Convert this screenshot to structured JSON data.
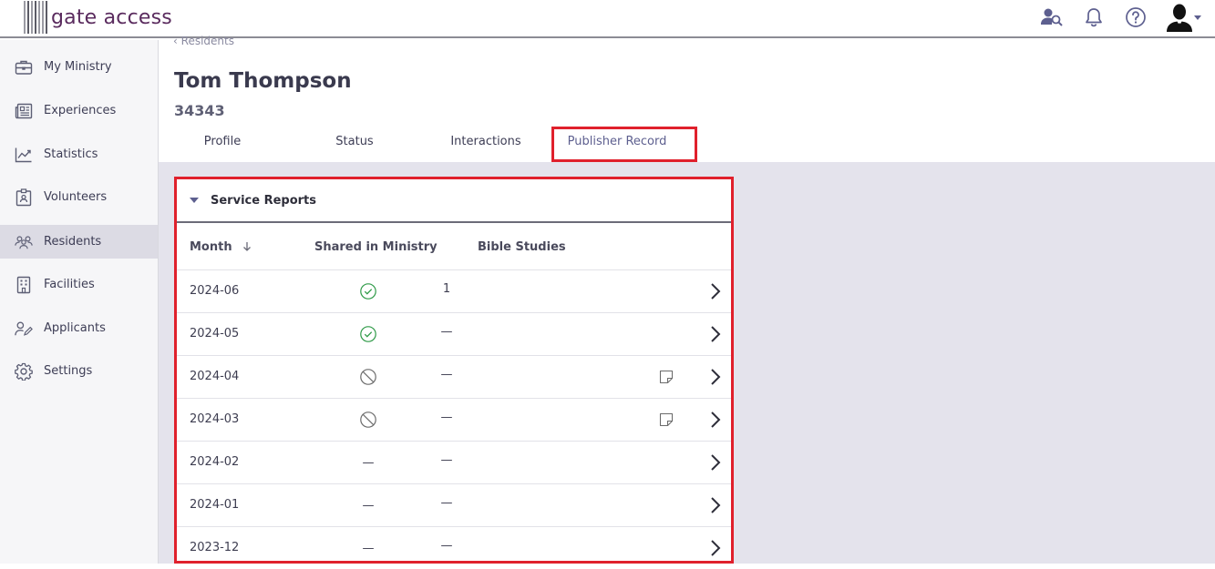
{
  "brand": {
    "name": "gate access"
  },
  "header_icons": [
    "resident-search-icon",
    "bell-icon",
    "help-icon",
    "avatar"
  ],
  "sidebar": {
    "items": [
      {
        "label": "My Ministry",
        "icon": "briefcase-icon",
        "active": false
      },
      {
        "label": "Experiences",
        "icon": "newspaper-icon",
        "active": false
      },
      {
        "label": "Statistics",
        "icon": "chart-line-icon",
        "active": false
      },
      {
        "label": "Volunteers",
        "icon": "id-badge-icon",
        "active": false
      },
      {
        "label": "Residents",
        "icon": "people-icon",
        "active": true
      },
      {
        "label": "Facilities",
        "icon": "building-icon",
        "active": false
      },
      {
        "label": "Applicants",
        "icon": "person-edit-icon",
        "active": false
      },
      {
        "label": "Settings",
        "icon": "gear-icon",
        "active": false
      }
    ]
  },
  "breadcrumb": {
    "label": "Residents"
  },
  "resident": {
    "name": "Tom Thompson",
    "id": "34343"
  },
  "tabs": [
    {
      "label": "Profile"
    },
    {
      "label": "Status"
    },
    {
      "label": "Interactions"
    },
    {
      "label": "Publisher Record",
      "selected": true
    }
  ],
  "service_reports": {
    "title": "Service Reports",
    "columns": {
      "month": "Month",
      "shared": "Shared in Ministry",
      "bible": "Bible Studies"
    },
    "rows": [
      {
        "month": "2024-06",
        "shared": "check",
        "bible": "1",
        "note": false
      },
      {
        "month": "2024-05",
        "shared": "check",
        "bible": "—",
        "note": false
      },
      {
        "month": "2024-04",
        "shared": "blocked",
        "bible": "—",
        "note": true
      },
      {
        "month": "2024-03",
        "shared": "blocked",
        "bible": "—",
        "note": true
      },
      {
        "month": "2024-02",
        "shared": "—",
        "bible": "—",
        "note": false
      },
      {
        "month": "2024-01",
        "shared": "—",
        "bible": "—",
        "note": false
      },
      {
        "month": "2023-12",
        "shared": "—",
        "bible": "—",
        "note": false
      }
    ]
  },
  "colors": {
    "highlight": "#e0202c",
    "brand": "#5a2b5e",
    "check": "#2e9a47"
  }
}
